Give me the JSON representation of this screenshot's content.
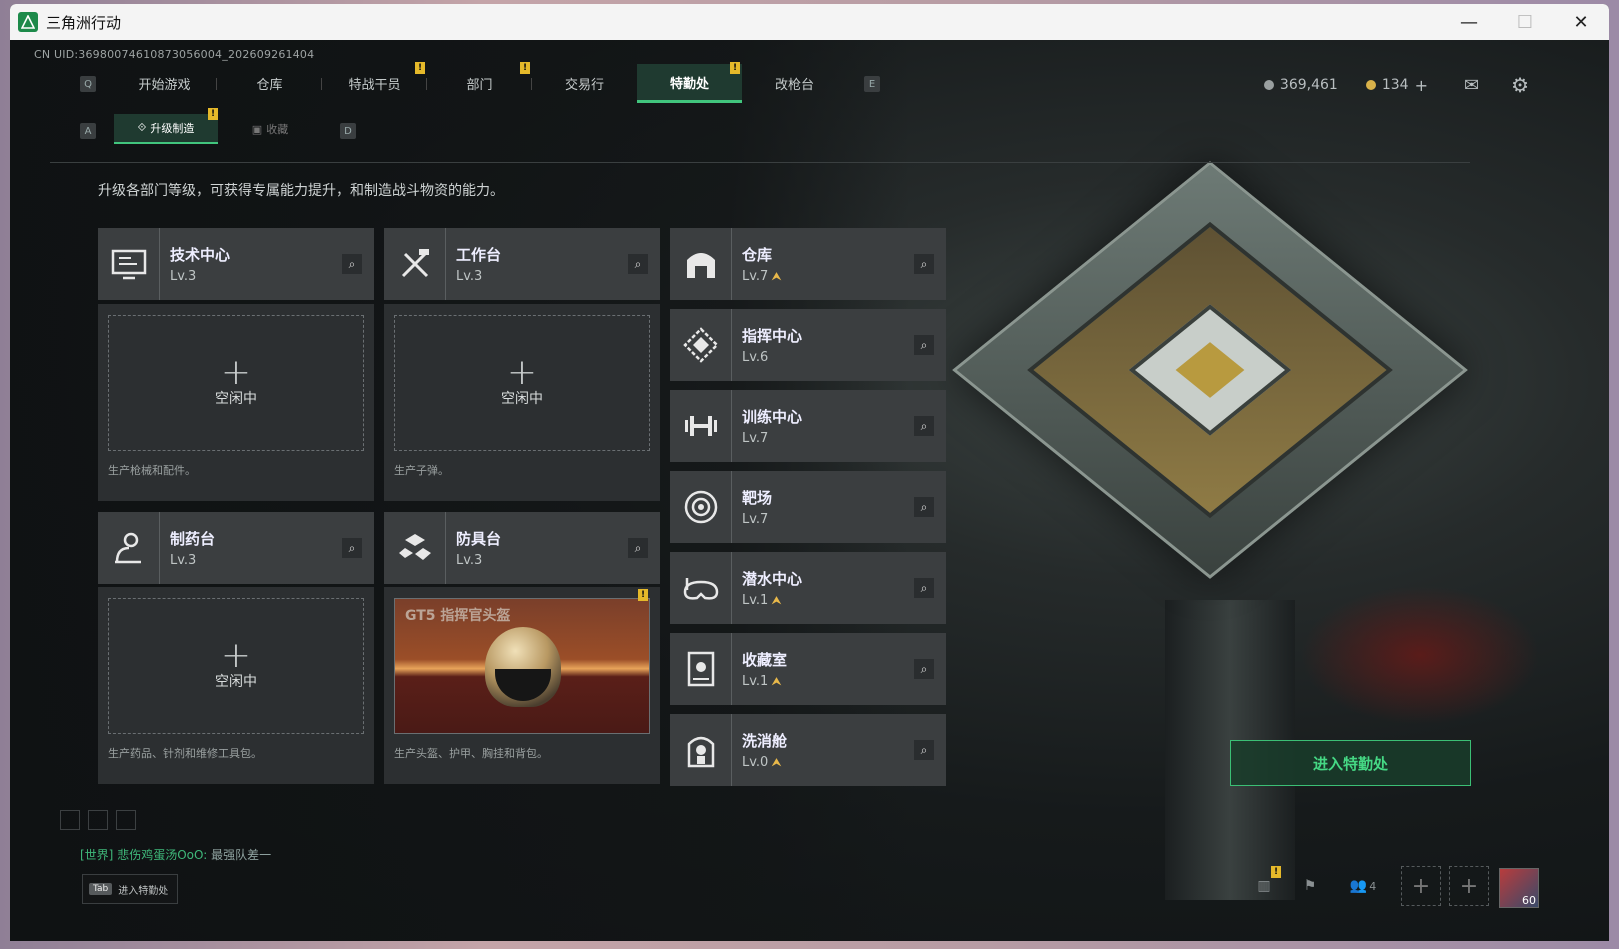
{
  "window": {
    "title": "三角洲行动",
    "controls": {
      "minimize": "—",
      "maximize": "☐",
      "close": "✕"
    }
  },
  "uid": "CN UID:3698007461087305600​4_202609261404",
  "tabs": [
    {
      "label": "开始游戏",
      "badge": ""
    },
    {
      "label": "仓库",
      "badge": ""
    },
    {
      "label": "特战干员",
      "badge": "!"
    },
    {
      "label": "部门",
      "badge": "!"
    },
    {
      "label": "交易行",
      "badge": ""
    },
    {
      "label": "特勤处",
      "badge": "!",
      "active": true
    },
    {
      "label": "改枪台",
      "badge": ""
    }
  ],
  "tab_keys": {
    "left": "Q",
    "right": "E"
  },
  "subtabs": [
    {
      "label": "升级制造",
      "active": true,
      "badge": "!"
    },
    {
      "label": "收藏",
      "active": false
    }
  ],
  "subtab_keys": {
    "left": "A",
    "right": "D"
  },
  "currency": {
    "gold": "369,461",
    "coupon": "134",
    "add": "+"
  },
  "description": "升级各部门等级，可获得专属能力提升，和制造战斗物资的能力。",
  "workshops": [
    {
      "name": "技术中心",
      "level": "Lv.3",
      "slot": {
        "status": "空闲中",
        "plus": "+"
      },
      "caption": "生产枪械和配件。",
      "icon": "monitor-icon"
    },
    {
      "name": "工作台",
      "level": "Lv.3",
      "slot": {
        "status": "空闲中",
        "plus": "+"
      },
      "caption": "生产子弹。",
      "icon": "tools-icon"
    },
    {
      "name": "制药台",
      "level": "Lv.3",
      "slot": {
        "status": "空闲中",
        "plus": "+"
      },
      "caption": "生产药品、针剂和维修工具包。",
      "icon": "microscope-icon"
    },
    {
      "name": "防具台",
      "level": "Lv.3",
      "slot": {
        "product": "GT5 指挥官头盔",
        "badge": "!"
      },
      "caption": "生产头盔、护甲、胸挂和背包。",
      "icon": "armor-icon"
    }
  ],
  "facilities": [
    {
      "name": "仓库",
      "level": "Lv.7",
      "upgrade": "⮝",
      "icon": "warehouse-icon"
    },
    {
      "name": "指挥中心",
      "level": "Lv.6",
      "upgrade": "",
      "icon": "command-icon"
    },
    {
      "name": "训练中心",
      "level": "Lv.7",
      "upgrade": "",
      "icon": "dumbbell-icon"
    },
    {
      "name": "靶场",
      "level": "Lv.7",
      "upgrade": "",
      "icon": "target-icon"
    },
    {
      "name": "潜水中心",
      "level": "Lv.1",
      "upgrade": "⮝",
      "icon": "dive-mask-icon"
    },
    {
      "name": "收藏室",
      "level": "Lv.1",
      "upgrade": "⮝",
      "icon": "collection-icon"
    },
    {
      "name": "洗消舱",
      "level": "Lv.0",
      "upgrade": "⮝",
      "icon": "decon-icon"
    }
  ],
  "enter_button": "进入特勤处",
  "chat": {
    "channel": "[世界]",
    "sender": "悲伤鸡蛋汤OoO:",
    "message": "最强队差一"
  },
  "tab_hint": {
    "key": "Tab",
    "label": "进入特勤处"
  },
  "bottom": {
    "friends_count": "4",
    "level": "60",
    "badge": "!"
  },
  "colors": {
    "accent": "#41c57d",
    "badge": "#e5b92a",
    "upgrade": "#e8b84a"
  }
}
